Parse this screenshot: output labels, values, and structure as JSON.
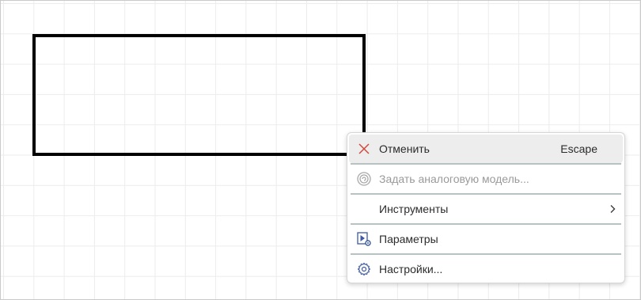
{
  "menu": {
    "items": [
      {
        "label": "Отменить",
        "shortcut": "Escape",
        "icon": "close-icon",
        "icon_color": "#d04a3c"
      },
      {
        "label": "Задать аналоговую модель...",
        "icon": "spiral-icon",
        "disabled": true
      },
      {
        "label": "Инструменты",
        "has_submenu": true
      },
      {
        "label": "Параметры",
        "icon": "play-gear-icon",
        "icon_color": "#3b5aa3"
      },
      {
        "label": "Настройки...",
        "icon": "gear-icon",
        "icon_color": "#3b5aa3"
      }
    ]
  }
}
